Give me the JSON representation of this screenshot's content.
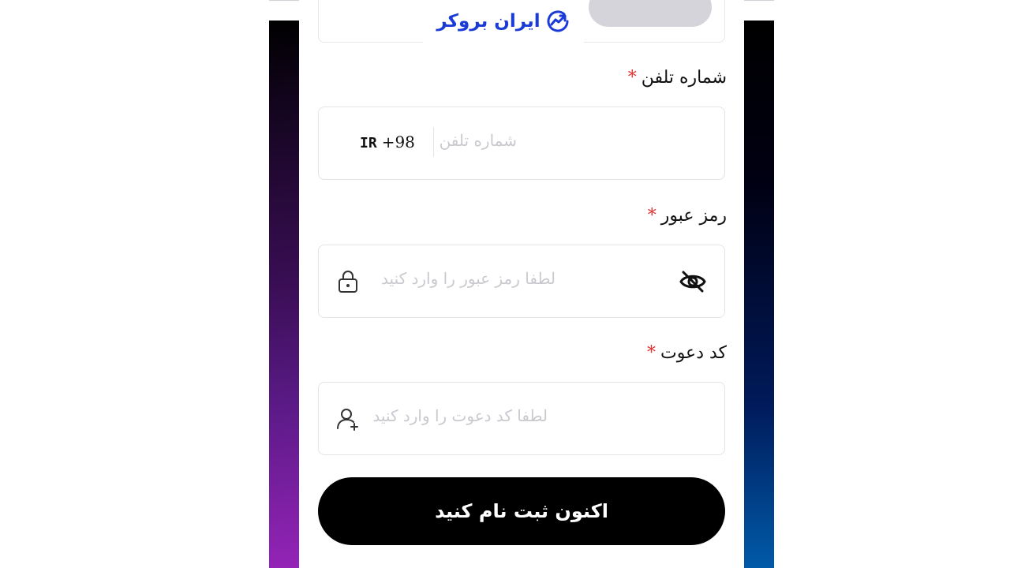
{
  "brand": {
    "name": "ایران بروکر",
    "color": "#1a3bd8"
  },
  "phone": {
    "label": "شماره تلفن",
    "required_mark": "*",
    "country_code": "IR",
    "dial_code": "+98",
    "placeholder": "شماره تلفن"
  },
  "password": {
    "label": "رمز عبور",
    "required_mark": "*",
    "placeholder": "لطفا رمز عبور را وارد کنید",
    "lead_icon": "lock-icon",
    "toggle_icon": "eye-off-icon"
  },
  "invite": {
    "label": "کد دعوت",
    "required_mark": "*",
    "placeholder": "لطفا کد دعوت را وارد کنید",
    "lead_icon": "user-plus-icon"
  },
  "submit": {
    "label": "اکنون ثبت نام کنید"
  },
  "colors": {
    "required": "#e03131",
    "button": "#000000"
  }
}
